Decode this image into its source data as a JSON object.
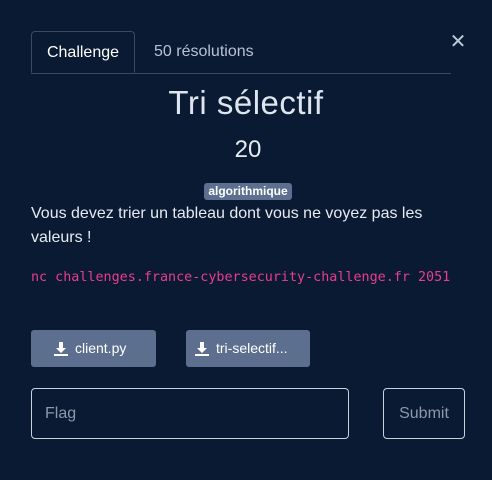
{
  "tabs": [
    {
      "label": "Challenge",
      "active": true
    },
    {
      "label": "50 résolutions",
      "active": false
    }
  ],
  "close_icon": "close-icon",
  "challenge": {
    "title": "Tri sélectif",
    "points": "20",
    "tag": "algorithmique",
    "description": "Vous devez trier un tableau dont vous ne voyez pas les valeurs !",
    "command": "nc challenges.france-cybersecurity-challenge.fr 2051"
  },
  "files": [
    {
      "label": "client.py",
      "icon": "download-icon"
    },
    {
      "label": "tri-selectif...",
      "icon": "download-icon"
    }
  ],
  "flag_form": {
    "placeholder": "Flag",
    "value": "",
    "submit_label": "Submit"
  },
  "colors": {
    "background": "#0a1a33",
    "tag_background": "#5d6f8e",
    "button_background": "#5d6f8e",
    "command_text": "#e83e8c"
  }
}
